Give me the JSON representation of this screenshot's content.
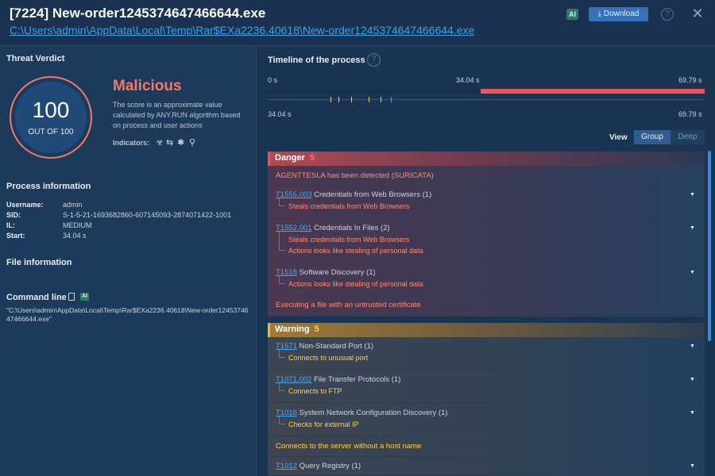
{
  "header": {
    "title": "[7224] New-order1245374647466644.exe",
    "path": "C:\\Users\\admin\\AppData\\Local\\Temp\\Rar$EXa2236.40618\\New-order1245374647466644.exe",
    "ai_badge": "AI",
    "download_label": "⤓ Download",
    "help_glyph": "?",
    "close_glyph": "✕"
  },
  "verdict": {
    "section_title": "Threat Verdict",
    "score": "100",
    "score_of": "OUT OF 100",
    "label": "Malicious",
    "description": "The score is an approximate value calculated by ANY.RUN algorithm based on process and user actions",
    "indicators_label": "Indicators:",
    "indicator_icons": [
      "biohazard-icon",
      "arrows-exchange-icon",
      "bug-icon",
      "network-icon"
    ],
    "ring_color": "#f07a6a"
  },
  "process_info": {
    "title": "Process information",
    "fields": [
      {
        "key": "Username:",
        "value": "admin"
      },
      {
        "key": "SID:",
        "value": "S-1-5-21-1693682860-607145093-2874071422-1001"
      },
      {
        "key": "IL:",
        "value": "MEDIUM"
      },
      {
        "key": "Start:",
        "value": "34.04 s"
      }
    ]
  },
  "file_info": {
    "title": "File information"
  },
  "command_line": {
    "title": "Command line",
    "ai_badge": "AI",
    "text": "\"C:\\Users\\admin\\AppData\\Local\\Temp\\Rar$EXa2236.40618\\New-order1245374647466644.exe\""
  },
  "timeline": {
    "title": "Timeline of the process",
    "help_glyph": "?",
    "start_label": "0 s",
    "mid_label": "34.04 s",
    "end_label": "69.79 s",
    "bottom_start": "34.04 s",
    "bottom_end": "69.79 s",
    "total_seconds": 69.79,
    "process_start_seconds": 34.04,
    "bar_color": "#e8555a"
  },
  "view": {
    "label": "View",
    "options": [
      "Group",
      "Deep"
    ],
    "selected": "Group"
  },
  "groups": {
    "danger": {
      "label": "Danger",
      "count": "5",
      "color": "#e8555a",
      "items": {
        "agenttesla": "AGENTTESLA has been detected (SURICATA)",
        "t1555": {
          "id": "T1555.003",
          "name": " Credentials from Web Browsers (1)",
          "subs": [
            "Steals credentials from Web Browsers"
          ]
        },
        "t1552": {
          "id": "T1552.001",
          "name": " Credentials In Files (2)",
          "subs": [
            "Steals credentials from Web Browsers",
            "Actions looks like stealing of personal data"
          ]
        },
        "t1518": {
          "id": "T1518",
          "name": " Software Discovery (1)",
          "subs": [
            "Actions looks like stealing of personal data"
          ]
        },
        "untrusted": "Executing a file with an untrusted certificate"
      }
    },
    "warning": {
      "label": "Warning",
      "count": "5",
      "color": "#e8b84a",
      "items": {
        "t1571": {
          "id": "T1571",
          "name": " Non-Standard Port (1)",
          "subs": [
            "Connects to unusual port"
          ]
        },
        "t1071": {
          "id": "T1071.002",
          "name": " File Transfer Protocols (1)",
          "subs": [
            "Connects to FTP"
          ]
        },
        "t1016": {
          "id": "T1016",
          "name": " System Network Configuration Discovery (1)",
          "subs": [
            "Checks for external IP"
          ]
        },
        "nohost": "Connects to the server without a host name",
        "t1012": {
          "id": "T1012",
          "name": " Query Registry (1)"
        }
      }
    }
  }
}
